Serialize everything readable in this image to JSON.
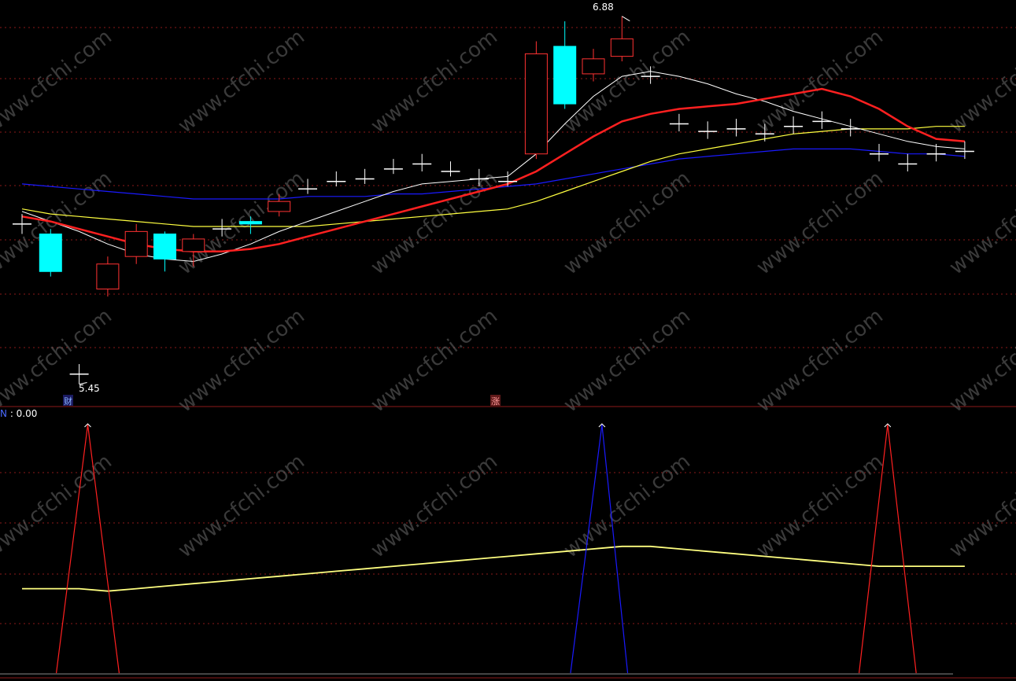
{
  "colors": {
    "background": "#000000",
    "grid": "#8b1a1a",
    "up_candle": "#ff3232",
    "down_candle": "#00ffff",
    "ma_white": "#ffffff",
    "ma_red": "#ff2020",
    "ma_yellow": "#ffff40",
    "ma_blue": "#1a1aff",
    "signal_red": "#ff2020",
    "signal_blue": "#1a1aff",
    "signal_yellow": "#ffff80"
  },
  "watermark": "www.cfchi.com",
  "main_panel": {
    "high_label": "6.88",
    "low_label": "5.45",
    "marker_left": "财",
    "marker_mid": "涨"
  },
  "indicator_panel": {
    "readout_name": "N",
    "readout_value": ": 0.00"
  },
  "chart_data": [
    {
      "type": "candlestick",
      "price_range": [
        5.38,
        6.92
      ],
      "candles": [
        {
          "o": 6.05,
          "c": 6.05,
          "h": 6.09,
          "l": 6.01
        },
        {
          "o": 6.01,
          "c": 5.86,
          "h": 6.03,
          "l": 5.84
        },
        {
          "o": 5.45,
          "c": 5.45,
          "h": 5.49,
          "l": 5.41
        },
        {
          "o": 5.79,
          "c": 5.89,
          "h": 5.92,
          "l": 5.76
        },
        {
          "o": 5.92,
          "c": 6.02,
          "h": 6.05,
          "l": 5.89
        },
        {
          "o": 6.01,
          "c": 5.91,
          "h": 6.02,
          "l": 5.86
        },
        {
          "o": 5.94,
          "c": 5.99,
          "h": 6.01,
          "l": 5.88
        },
        {
          "o": 6.03,
          "c": 6.03,
          "h": 6.07,
          "l": 6.0
        },
        {
          "o": 6.06,
          "c": 6.05,
          "h": 6.08,
          "l": 6.01
        },
        {
          "o": 6.1,
          "c": 6.14,
          "h": 6.17,
          "l": 6.08
        },
        {
          "o": 6.19,
          "c": 6.19,
          "h": 6.23,
          "l": 6.17
        },
        {
          "o": 6.22,
          "c": 6.22,
          "h": 6.26,
          "l": 6.2
        },
        {
          "o": 6.23,
          "c": 6.23,
          "h": 6.27,
          "l": 6.21
        },
        {
          "o": 6.27,
          "c": 6.27,
          "h": 6.31,
          "l": 6.25
        },
        {
          "o": 6.29,
          "c": 6.29,
          "h": 6.33,
          "l": 6.26
        },
        {
          "o": 6.26,
          "c": 6.26,
          "h": 6.3,
          "l": 6.24
        },
        {
          "o": 6.23,
          "c": 6.23,
          "h": 6.27,
          "l": 6.2
        },
        {
          "o": 6.22,
          "c": 6.22,
          "h": 6.26,
          "l": 6.2
        },
        {
          "o": 6.33,
          "c": 6.73,
          "h": 6.78,
          "l": 6.31
        },
        {
          "o": 6.76,
          "c": 6.53,
          "h": 6.86,
          "l": 6.51
        },
        {
          "o": 6.65,
          "c": 6.71,
          "h": 6.75,
          "l": 6.62
        },
        {
          "o": 6.72,
          "c": 6.79,
          "h": 6.88,
          "l": 6.7
        },
        {
          "o": 6.64,
          "c": 6.64,
          "h": 6.68,
          "l": 6.61
        },
        {
          "o": 6.45,
          "c": 6.45,
          "h": 6.49,
          "l": 6.42
        },
        {
          "o": 6.42,
          "c": 6.42,
          "h": 6.46,
          "l": 6.39
        },
        {
          "o": 6.43,
          "c": 6.43,
          "h": 6.47,
          "l": 6.4
        },
        {
          "o": 6.41,
          "c": 6.41,
          "h": 6.45,
          "l": 6.38
        },
        {
          "o": 6.44,
          "c": 6.44,
          "h": 6.48,
          "l": 6.41
        },
        {
          "o": 6.46,
          "c": 6.46,
          "h": 6.5,
          "l": 6.43
        },
        {
          "o": 6.43,
          "c": 6.43,
          "h": 6.47,
          "l": 6.4
        },
        {
          "o": 6.33,
          "c": 6.33,
          "h": 6.37,
          "l": 6.3
        },
        {
          "o": 6.29,
          "c": 6.29,
          "h": 6.33,
          "l": 6.26
        },
        {
          "o": 6.33,
          "c": 6.33,
          "h": 6.37,
          "l": 6.3
        },
        {
          "o": 6.34,
          "c": 6.34,
          "h": 6.38,
          "l": 6.31
        }
      ],
      "ma_white": [
        6.1,
        6.06,
        6.02,
        5.97,
        5.93,
        5.91,
        5.9,
        5.93,
        5.97,
        6.02,
        6.06,
        6.1,
        6.14,
        6.18,
        6.21,
        6.22,
        6.23,
        6.24,
        6.33,
        6.45,
        6.56,
        6.64,
        6.66,
        6.64,
        6.61,
        6.57,
        6.54,
        6.5,
        6.47,
        6.44,
        6.41,
        6.38,
        6.36,
        6.35
      ],
      "ma_red": [
        6.08,
        6.06,
        6.03,
        6.0,
        5.97,
        5.95,
        5.94,
        5.94,
        5.95,
        5.97,
        6.0,
        6.03,
        6.06,
        6.09,
        6.12,
        6.15,
        6.18,
        6.21,
        6.26,
        6.33,
        6.4,
        6.46,
        6.49,
        6.51,
        6.52,
        6.53,
        6.55,
        6.57,
        6.59,
        6.56,
        6.51,
        6.44,
        6.39,
        6.38
      ],
      "ma_yellow": [
        6.11,
        6.09,
        6.08,
        6.07,
        6.06,
        6.05,
        6.04,
        6.04,
        6.04,
        6.04,
        6.04,
        6.05,
        6.06,
        6.07,
        6.08,
        6.09,
        6.1,
        6.11,
        6.14,
        6.18,
        6.22,
        6.26,
        6.3,
        6.33,
        6.35,
        6.37,
        6.39,
        6.41,
        6.42,
        6.43,
        6.43,
        6.43,
        6.44,
        6.44
      ],
      "ma_blue": [
        6.21,
        6.2,
        6.19,
        6.18,
        6.17,
        6.16,
        6.15,
        6.15,
        6.15,
        6.15,
        6.16,
        6.16,
        6.16,
        6.17,
        6.17,
        6.18,
        6.19,
        6.2,
        6.21,
        6.23,
        6.25,
        6.27,
        6.29,
        6.31,
        6.32,
        6.33,
        6.34,
        6.35,
        6.35,
        6.35,
        6.34,
        6.33,
        6.33,
        6.32
      ]
    },
    {
      "type": "line",
      "y_range": [
        0,
        1
      ],
      "yellow_line": [
        0.34,
        0.34,
        0.34,
        0.33,
        0.34,
        0.35,
        0.36,
        0.37,
        0.38,
        0.39,
        0.4,
        0.41,
        0.42,
        0.43,
        0.44,
        0.45,
        0.46,
        0.47,
        0.48,
        0.49,
        0.5,
        0.51,
        0.51,
        0.5,
        0.49,
        0.48,
        0.47,
        0.46,
        0.45,
        0.44,
        0.43,
        0.43,
        0.43,
        0.43
      ],
      "spikes": [
        {
          "bar": 2.3,
          "color": "red",
          "start": 1.2,
          "end": 3.4
        },
        {
          "bar": 20.3,
          "color": "blue",
          "start": 19.2,
          "end": 21.2
        },
        {
          "bar": 30.3,
          "color": "red",
          "start": 29.3,
          "end": 31.3
        }
      ]
    }
  ]
}
